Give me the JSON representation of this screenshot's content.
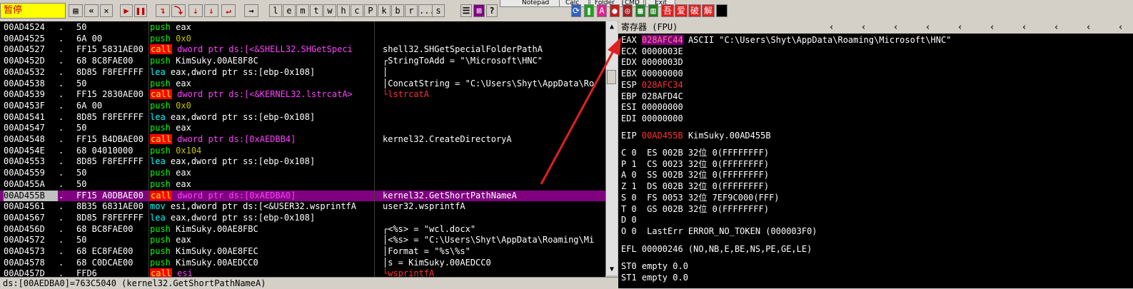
{
  "toolbar": {
    "status": "暂停",
    "tool_buttons": [
      "l",
      "e",
      "m",
      "t",
      "w",
      "h",
      "c",
      "P",
      "k",
      "b",
      "r",
      "...",
      "s"
    ],
    "top_tabs": [
      "Notepad",
      "Calc",
      "Folder",
      "CMD",
      "Exit"
    ],
    "right_buttons": [
      "吾",
      "爱",
      "破",
      "解"
    ]
  },
  "disasm": [
    {
      "addr": "00AD4524",
      "dot": ".",
      "hex": "50",
      "mn": "push",
      "ops": "eax",
      "mn_style": "push",
      "op_style": "w",
      "comment": "",
      "com_style": ""
    },
    {
      "addr": "00AD4525",
      "dot": ".",
      "hex": "6A 00",
      "mn": "push",
      "ops": "0x0",
      "mn_style": "push",
      "op_style": "imm",
      "comment": "",
      "com_style": ""
    },
    {
      "addr": "00AD4527",
      "dot": ".",
      "hex": "FF15 5831AE00",
      "mn": "call",
      "ops": "dword ptr ds:[<&SHELL32.SHGetSpeci",
      "mn_style": "call",
      "op_style": "call",
      "comment": "shell32.SHGetSpecialFolderPathA",
      "com_style": ""
    },
    {
      "addr": "00AD452D",
      "dot": ".",
      "hex": "68 8C8FAE00",
      "mn": "push",
      "ops": "KimSuky.00AE8F8C",
      "mn_style": "push",
      "op_style": "w",
      "comment": "┌StringToAdd = \"\\Microsoft\\HNC\"",
      "com_style": ""
    },
    {
      "addr": "00AD4532",
      "dot": ".",
      "hex": "8D85 F8FEFFFF",
      "mn": "lea",
      "ops": "eax,dword ptr ss:[ebp-0x108]",
      "mn_style": "lea",
      "op_style": "w",
      "comment": "│",
      "com_style": ""
    },
    {
      "addr": "00AD4538",
      "dot": ".",
      "hex": "50",
      "mn": "push",
      "ops": "eax",
      "mn_style": "push",
      "op_style": "w",
      "comment": "│ConcatString = \"C:\\Users\\Shyt\\AppData\\Ro",
      "com_style": ""
    },
    {
      "addr": "00AD4539",
      "dot": ".",
      "hex": "FF15 2830AE00",
      "mn": "call",
      "ops": "dword ptr ds:[<&KERNEL32.lstrcatA>",
      "mn_style": "call",
      "op_style": "call",
      "comment": "└lstrcatA",
      "com_style": "red"
    },
    {
      "addr": "00AD453F",
      "dot": ".",
      "hex": "6A 00",
      "mn": "push",
      "ops": "0x0",
      "mn_style": "push",
      "op_style": "imm",
      "comment": "",
      "com_style": ""
    },
    {
      "addr": "00AD4541",
      "dot": ".",
      "hex": "8D85 F8FEFFFF",
      "mn": "lea",
      "ops": "eax,dword ptr ss:[ebp-0x108]",
      "mn_style": "lea",
      "op_style": "w",
      "comment": "",
      "com_style": ""
    },
    {
      "addr": "00AD4547",
      "dot": ".",
      "hex": "50",
      "mn": "push",
      "ops": "eax",
      "mn_style": "push",
      "op_style": "w",
      "comment": "",
      "com_style": ""
    },
    {
      "addr": "00AD4548",
      "dot": ".",
      "hex": "FF15 B4DBAE00",
      "mn": "call",
      "ops": "dword ptr ds:[0xAEDBB4]",
      "mn_style": "call",
      "op_style": "call",
      "comment": "kernel32.CreateDirectoryA",
      "com_style": ""
    },
    {
      "addr": "00AD454E",
      "dot": ".",
      "hex": "68 04010000",
      "mn": "push",
      "ops": "0x104",
      "mn_style": "push",
      "op_style": "imm",
      "comment": "",
      "com_style": ""
    },
    {
      "addr": "00AD4553",
      "dot": ".",
      "hex": "8D85 F8FEFFFF",
      "mn": "lea",
      "ops": "eax,dword ptr ss:[ebp-0x108]",
      "mn_style": "lea",
      "op_style": "w",
      "comment": "",
      "com_style": ""
    },
    {
      "addr": "00AD4559",
      "dot": ".",
      "hex": "50",
      "mn": "push",
      "ops": "eax",
      "mn_style": "push",
      "op_style": "w",
      "comment": "",
      "com_style": ""
    },
    {
      "addr": "00AD455A",
      "dot": ".",
      "hex": "50",
      "mn": "push",
      "ops": "eax",
      "mn_style": "push",
      "op_style": "w",
      "comment": "",
      "com_style": ""
    },
    {
      "addr": "00AD455B",
      "dot": ".",
      "hex": "FF15 A0DBAE00",
      "mn": "call",
      "ops": "dword ptr ds:[0xAEDBA0]",
      "mn_style": "call",
      "op_style": "call",
      "comment": "kernel32.GetShortPathNameA",
      "com_style": "",
      "selected": true
    },
    {
      "addr": "00AD4561",
      "dot": ".",
      "hex": "8B35 6831AE00",
      "mn": "mov",
      "ops": "esi,dword ptr ds:[<&USER32.wsprintfA",
      "mn_style": "mov",
      "op_style": "w",
      "comment": "user32.wsprintfA",
      "com_style": ""
    },
    {
      "addr": "00AD4567",
      "dot": ".",
      "hex": "8D85 F8FEFFFF",
      "mn": "lea",
      "ops": "eax,dword ptr ss:[ebp-0x108]",
      "mn_style": "lea",
      "op_style": "w",
      "comment": "",
      "com_style": ""
    },
    {
      "addr": "00AD456D",
      "dot": ".",
      "hex": "68 BC8FAE00",
      "mn": "push",
      "ops": "KimSuky.00AE8FBC",
      "mn_style": "push",
      "op_style": "w",
      "comment": "┌<%s> = \"wcl.docx\"",
      "com_style": ""
    },
    {
      "addr": "00AD4572",
      "dot": ".",
      "hex": "50",
      "mn": "push",
      "ops": "eax",
      "mn_style": "push",
      "op_style": "w",
      "comment": "│<%s> = \"C:\\Users\\Shyt\\AppData\\Roaming\\Mi",
      "com_style": ""
    },
    {
      "addr": "00AD4573",
      "dot": ".",
      "hex": "68 EC8FAE00",
      "mn": "push",
      "ops": "KimSuky.00AE8FEC",
      "mn_style": "push",
      "op_style": "w",
      "comment": "│Format = \"%s\\%s\"",
      "com_style": ""
    },
    {
      "addr": "00AD4578",
      "dot": ".",
      "hex": "68 C0DCAE00",
      "mn": "push",
      "ops": "KimSuky.00AEDCC0",
      "mn_style": "push",
      "op_style": "w",
      "comment": "│s = KimSuky.00AEDCC0",
      "com_style": ""
    },
    {
      "addr": "00AD457D",
      "dot": ".",
      "hex": "FFD6",
      "mn": "call",
      "ops": "esi",
      "mn_style": "call",
      "op_style": "call",
      "comment": "└wsprintfA",
      "com_style": "red"
    }
  ],
  "statusbar": "ds:[00AEDBA0]=763C5040 (kernel32.GetShortPathNameA)",
  "registers": {
    "title": "寄存器 (FPU)",
    "gp": [
      {
        "name": "EAX",
        "value": "028AFC44",
        "note": "ASCII \"C:\\Users\\Shyt\\AppData\\Roaming\\Microsoft\\HNC\"",
        "style": "hl"
      },
      {
        "name": "ECX",
        "value": "0000003E",
        "note": "",
        "style": ""
      },
      {
        "name": "EDX",
        "value": "0000003D",
        "note": "",
        "style": ""
      },
      {
        "name": "EBX",
        "value": "00000000",
        "note": "",
        "style": ""
      },
      {
        "name": "ESP",
        "value": "028AFC34",
        "note": "",
        "style": "red"
      },
      {
        "name": "EBP",
        "value": "028AFD4C",
        "note": "",
        "style": ""
      },
      {
        "name": "ESI",
        "value": "00000000",
        "note": "",
        "style": ""
      },
      {
        "name": "EDI",
        "value": "00000000",
        "note": "",
        "style": ""
      }
    ],
    "eip": {
      "name": "EIP",
      "value": "00AD455B",
      "note": "KimSuky.00AD455B"
    },
    "segs": [
      "C 0  ES 002B 32位 0(FFFFFFFF)",
      "P 1  CS 0023 32位 0(FFFFFFFF)",
      "A 0  SS 002B 32位 0(FFFFFFFF)",
      "Z 1  DS 002B 32位 0(FFFFFFFF)",
      "S 0  FS 0053 32位 7EF9C000(FFF)",
      "T 0  GS 002B 32位 0(FFFFFFFF)",
      "D 0",
      "O 0  LastErr ERROR_NO_TOKEN (000003F0)"
    ],
    "efl": "EFL 00000246 (NO,NB,E,BE,NS,PE,GE,LE)",
    "fpu": [
      "ST0 empty 0.0",
      "ST1 empty 0.0"
    ]
  },
  "colors": {
    "annotation_arrow": "#e02020",
    "selected_row": "#800080"
  }
}
